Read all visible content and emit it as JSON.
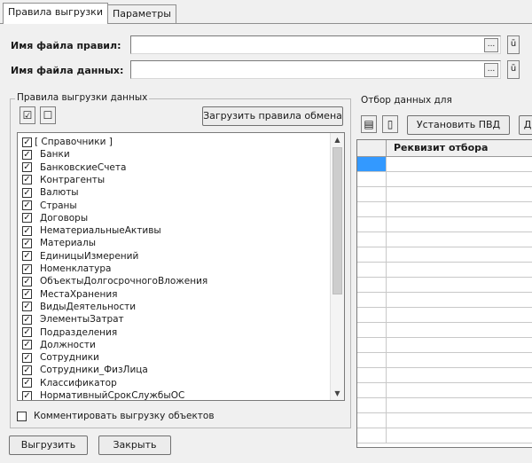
{
  "tabs": [
    {
      "label": "Правила выгрузки",
      "active": true
    },
    {
      "label": "Параметры",
      "active": false
    }
  ],
  "rules_file": {
    "label": "Имя файла правил:",
    "value": "",
    "select_icon": "...",
    "open_icon": "ū"
  },
  "data_file": {
    "label": "Имя файла данных:",
    "value": "",
    "select_icon": "...",
    "open_icon": "ū"
  },
  "rules_group": {
    "title": "Правила выгрузки данных",
    "check_all_icon": "check-all-icon",
    "uncheck_all_icon": "uncheck-all-icon",
    "check_all_glyph": "☑",
    "uncheck_all_glyph": "☐",
    "load_button": "Загрузить правила обмена",
    "items": [
      {
        "label": "[ Справочники ]",
        "checked": true
      },
      {
        "label": "Банки",
        "checked": true
      },
      {
        "label": "БанковскиеСчета",
        "checked": true
      },
      {
        "label": "Контрагенты",
        "checked": true
      },
      {
        "label": "Валюты",
        "checked": true
      },
      {
        "label": "Страны",
        "checked": true
      },
      {
        "label": "Договоры",
        "checked": true
      },
      {
        "label": "НематериальныеАктивы",
        "checked": true
      },
      {
        "label": "Материалы",
        "checked": true
      },
      {
        "label": "ЕдиницыИзмерений",
        "checked": true
      },
      {
        "label": "Номенклатура",
        "checked": true
      },
      {
        "label": "ОбъектыДолгосрочногоВложения",
        "checked": true
      },
      {
        "label": "МестаХранения",
        "checked": true
      },
      {
        "label": "ВидыДеятельности",
        "checked": true
      },
      {
        "label": "ЭлементыЗатрат",
        "checked": true
      },
      {
        "label": "Подразделения",
        "checked": true
      },
      {
        "label": "Должности",
        "checked": true
      },
      {
        "label": "Сотрудники",
        "checked": true
      },
      {
        "label": "Сотрудники_ФизЛица",
        "checked": true
      },
      {
        "label": "Классификатор",
        "checked": true
      },
      {
        "label": "НормативныйСрокСлужбыОС",
        "checked": true
      },
      {
        "label": "...",
        "checked": true
      }
    ],
    "comment_checkbox": {
      "label": "Комментировать выгрузку объектов",
      "checked": false
    }
  },
  "filter_group": {
    "title": "Отбор данных для",
    "add_icon": "add-row-icon",
    "remove_icon": "remove-row-icon",
    "add_glyph": "▤",
    "remove_glyph": "▯",
    "set_button": "Установить ПВД",
    "extra_button": "Д",
    "column_header": "Реквизит отбора"
  },
  "bottom_buttons": {
    "export": "Выгрузить",
    "close": "Закрыть"
  },
  "colors": {
    "selection_cell": "#3399ff",
    "window_bg": "#f0f0f0"
  }
}
